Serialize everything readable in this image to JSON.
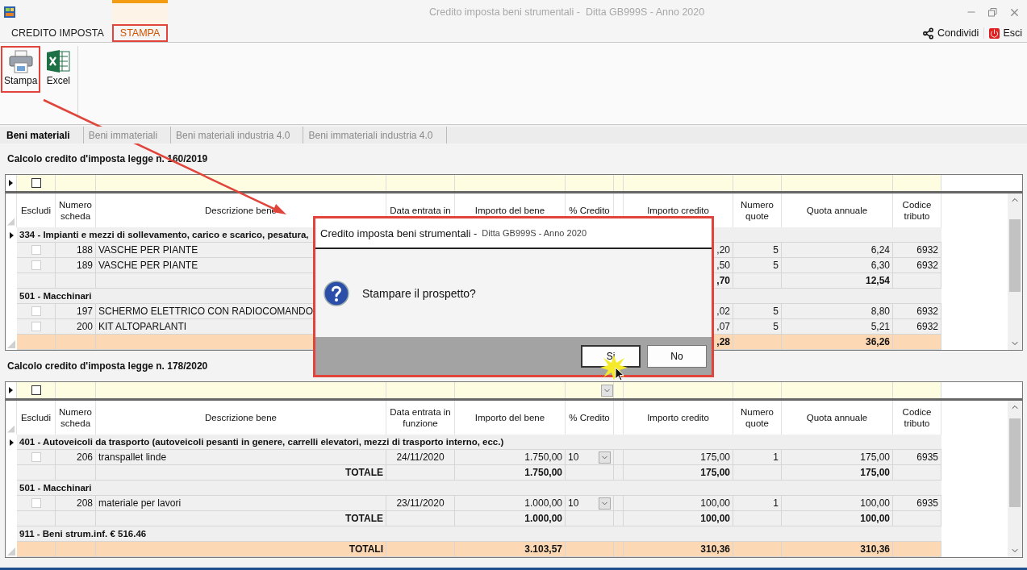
{
  "window": {
    "title": "Credito imposta beni strumentali -  Ditta GB999S - Anno 2020"
  },
  "ribbon_tabs": [
    {
      "label": "CREDITO IMPOSTA",
      "selected": false,
      "highlighted": false
    },
    {
      "label": "STAMPA",
      "selected": true,
      "highlighted": true
    }
  ],
  "ribbon_actions": [
    {
      "kind": "share",
      "label": "Condividi"
    },
    {
      "kind": "exit",
      "label": "Esci"
    }
  ],
  "toolbar": [
    {
      "kind": "print",
      "label": "Stampa",
      "highlighted": true
    },
    {
      "kind": "excel",
      "label": "Excel",
      "highlighted": false
    }
  ],
  "sheet_tabs": [
    {
      "label": "Beni materiali",
      "selected": true
    },
    {
      "label": "Beni immateriali",
      "selected": false
    },
    {
      "label": "Beni materiali industria 4.0",
      "selected": false
    },
    {
      "label": "Beni immateriali industria 4.0",
      "selected": false
    }
  ],
  "grids": [
    {
      "title": "Calcolo credito d'imposta legge n. 160/2019",
      "filter": {
        "checked": false,
        "dropdown": false
      },
      "columns": [
        "Escludi",
        "Numero scheda",
        "Descrizione bene",
        "Data entrata in",
        "Importo del bene",
        "% Credito",
        "Importo credito",
        "Numero quote",
        "Quota annuale",
        "Codice tributo"
      ],
      "rows": [
        {
          "kind": "group",
          "current": true,
          "label": "334 - Impianti e mezzi di sollevamento, carico e scarico, pesatura,"
        },
        {
          "kind": "item",
          "current": false,
          "excluded": false,
          "number": "188",
          "description": "VASCHE PER PIANTE",
          "credit": ",20",
          "quotas": "5",
          "annual": "6,24",
          "code": "6932"
        },
        {
          "kind": "item",
          "current": false,
          "excluded": false,
          "number": "189",
          "description": "VASCHE PER PIANTE",
          "credit": ",50",
          "quotas": "5",
          "annual": "6,30",
          "code": "6932"
        },
        {
          "kind": "total",
          "current": false,
          "credit": ",70",
          "annual": "12,54"
        },
        {
          "kind": "group",
          "current": false,
          "label": "501 - Macchinari"
        },
        {
          "kind": "item",
          "current": false,
          "excluded": false,
          "number": "197",
          "description": "SCHERMO ELETTRICO CON RADIOCOMANDO",
          "credit": ",02",
          "quotas": "5",
          "annual": "8,80",
          "code": "6932"
        },
        {
          "kind": "item",
          "current": false,
          "excluded": false,
          "number": "200",
          "description": "KIT ALTOPARLANTI",
          "credit": ",07",
          "quotas": "5",
          "annual": "5,21",
          "code": "6932"
        },
        {
          "kind": "grand_total",
          "current": false,
          "credit": ",28",
          "annual": "36,26"
        }
      ]
    },
    {
      "title": "Calcolo credito d'imposta legge n. 178/2020",
      "filter": {
        "checked": false,
        "dropdown": true
      },
      "columns": [
        "Escludi",
        "Numero scheda",
        "Descrizione bene",
        "Data entrata in funzione",
        "Importo del bene",
        "% Credito",
        "Importo credito",
        "Numero quote",
        "Quota annuale",
        "Codice tributo"
      ],
      "rows": [
        {
          "kind": "group",
          "current": true,
          "label": "401 - Autoveicoli da trasporto (autoveicoli pesanti in genere, carrelli elevatori, mezzi di trasporto interno, ecc.)"
        },
        {
          "kind": "item",
          "current": false,
          "excluded": false,
          "number": "206",
          "description": "transpallet linde",
          "date": "24/11/2020",
          "amount": "1.750,00",
          "percent": "10",
          "credit": "175,00",
          "quotas": "1",
          "annual": "175,00",
          "code": "6935"
        },
        {
          "kind": "total",
          "current": false,
          "label": "TOTALE",
          "amount": "1.750,00",
          "credit": "175,00",
          "annual": "175,00"
        },
        {
          "kind": "group",
          "current": false,
          "label": "501 - Macchinari"
        },
        {
          "kind": "item",
          "current": false,
          "excluded": false,
          "number": "208",
          "description": "materiale per lavori",
          "date": "23/11/2020",
          "amount": "1.000,00",
          "percent": "10",
          "credit": "100,00",
          "quotas": "1",
          "annual": "100,00",
          "code": "6935"
        },
        {
          "kind": "total",
          "current": false,
          "label": "TOTALE",
          "amount": "1.000,00",
          "credit": "100,00",
          "annual": "100,00"
        },
        {
          "kind": "group",
          "current": false,
          "label": "911 - Beni strum.inf. € 516.46"
        },
        {
          "kind": "grand_total",
          "current": false,
          "label": "TOTALI",
          "amount": "3.103,57",
          "credit": "310,36",
          "annual": "310,36"
        }
      ]
    }
  ],
  "dialog": {
    "title": "Credito imposta beni strumentali -",
    "subtitle": "Ditta GB999S - Anno 2020",
    "message": "Stampare il prospetto?",
    "buttons": [
      {
        "label": "Si",
        "focused": true
      },
      {
        "label": "No",
        "focused": false
      }
    ]
  }
}
